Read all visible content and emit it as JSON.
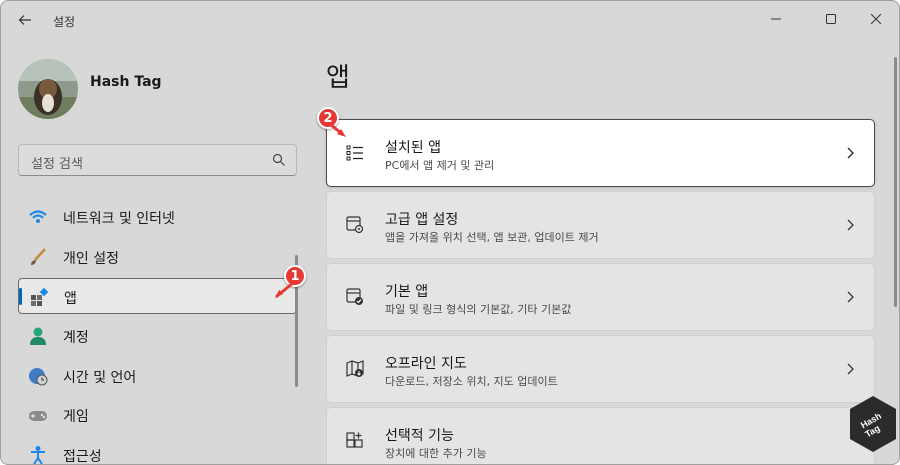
{
  "window": {
    "title": "설정"
  },
  "user": {
    "name": "Hash Tag"
  },
  "search": {
    "placeholder": "설정 검색"
  },
  "sidebar": {
    "items": [
      {
        "label": "네트워크 및 인터넷",
        "icon": "wifi-icon"
      },
      {
        "label": "개인 설정",
        "icon": "brush-icon"
      },
      {
        "label": "앱",
        "icon": "apps-icon",
        "selected": true
      },
      {
        "label": "계정",
        "icon": "person-icon"
      },
      {
        "label": "시간 및 언어",
        "icon": "globe-clock-icon"
      },
      {
        "label": "게임",
        "icon": "gamepad-icon"
      },
      {
        "label": "접근성",
        "icon": "accessibility-icon"
      }
    ]
  },
  "main": {
    "title": "앱",
    "cards": [
      {
        "title": "설치된 앱",
        "desc": "PC에서 앱 제거 및 관리",
        "icon": "list-icon",
        "highlighted": true
      },
      {
        "title": "고급 앱 설정",
        "desc": "앱을 가져올 위치 선택, 앱 보관, 업데이트 제거",
        "icon": "app-settings-icon"
      },
      {
        "title": "기본 앱",
        "desc": "파일 및 링크 형식의 기본값, 기타 기본값",
        "icon": "default-apps-icon"
      },
      {
        "title": "오프라인 지도",
        "desc": "다운로드, 저장소 위치, 지도 업데이트",
        "icon": "map-download-icon"
      },
      {
        "title": "선택적 기능",
        "desc": "장치에 대한 추가 기능",
        "icon": "optional-features-icon"
      }
    ]
  },
  "callouts": {
    "first": "1",
    "second": "2"
  },
  "watermark": {
    "text": "Hash Tag"
  },
  "colors": {
    "accent": "#0067c0",
    "callout": "#e53935"
  }
}
